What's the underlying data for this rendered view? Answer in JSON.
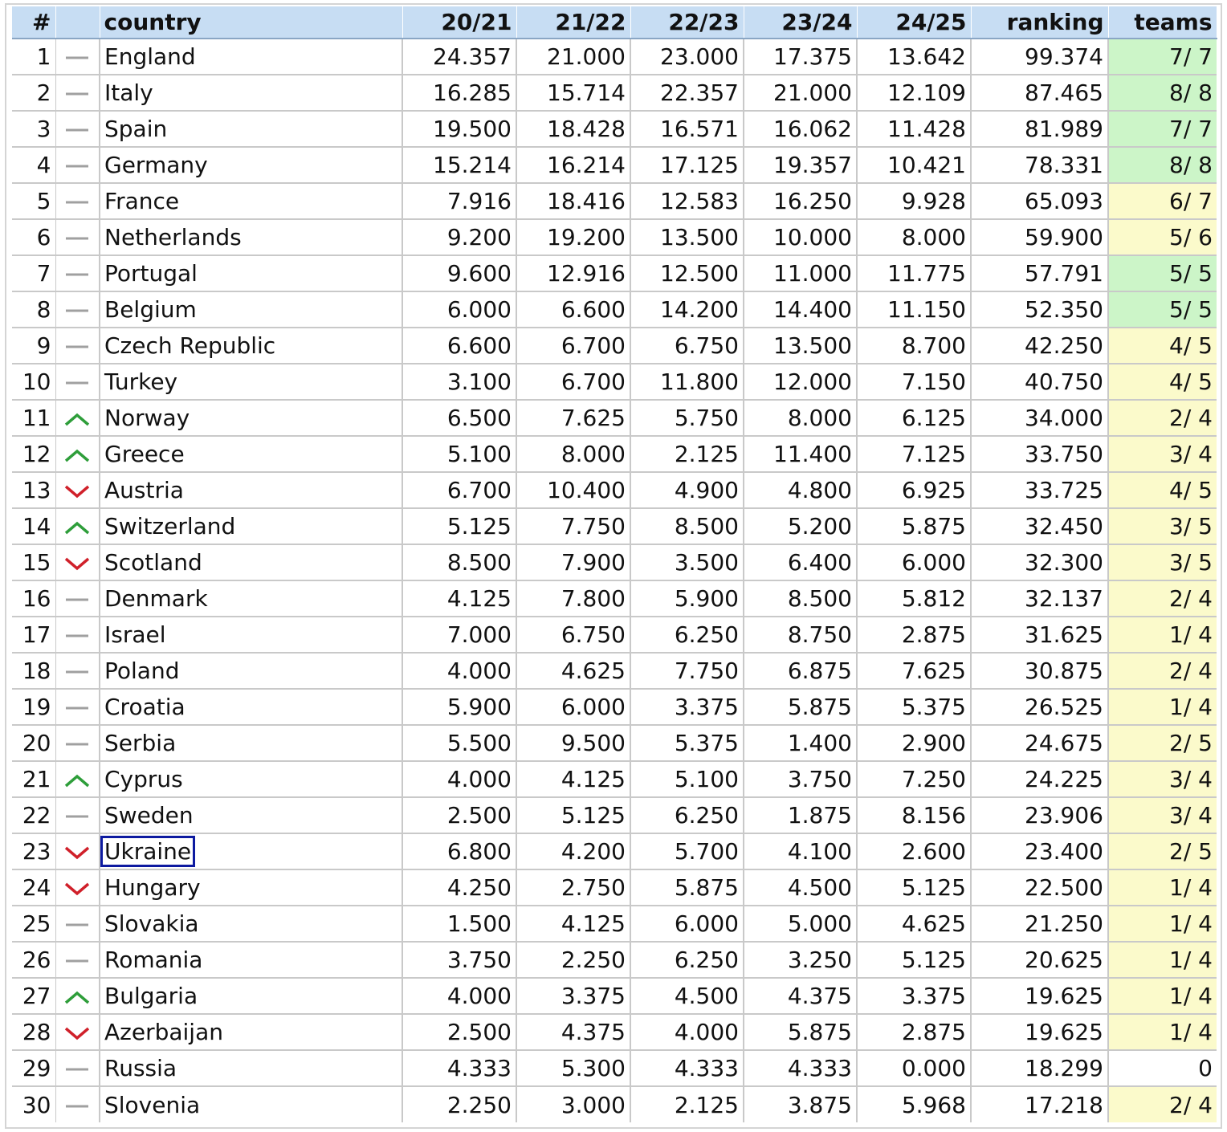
{
  "table": {
    "headers": [
      "#",
      "",
      "country",
      "20/21",
      "21/22",
      "22/23",
      "23/24",
      "24/25",
      "ranking",
      "teams"
    ],
    "selected_country": "Ukraine",
    "colors": {
      "full": "#ccf5c8",
      "partial": "#fbfacb",
      "up": "#2e9e3a",
      "down": "#d0202a",
      "same": "#a0a0a0",
      "header": "#c7ddf3",
      "selection": "#0d1aa0"
    },
    "rows": [
      {
        "rank": "1",
        "trend": "same",
        "country": "England",
        "s1": "24.357",
        "s2": "21.000",
        "s3": "23.000",
        "s4": "17.375",
        "s5": "13.642",
        "ranking": "99.374",
        "teams": "7/ 7",
        "teams_status": "full"
      },
      {
        "rank": "2",
        "trend": "same",
        "country": "Italy",
        "s1": "16.285",
        "s2": "15.714",
        "s3": "22.357",
        "s4": "21.000",
        "s5": "12.109",
        "ranking": "87.465",
        "teams": "8/ 8",
        "teams_status": "full"
      },
      {
        "rank": "3",
        "trend": "same",
        "country": "Spain",
        "s1": "19.500",
        "s2": "18.428",
        "s3": "16.571",
        "s4": "16.062",
        "s5": "11.428",
        "ranking": "81.989",
        "teams": "7/ 7",
        "teams_status": "full"
      },
      {
        "rank": "4",
        "trend": "same",
        "country": "Germany",
        "s1": "15.214",
        "s2": "16.214",
        "s3": "17.125",
        "s4": "19.357",
        "s5": "10.421",
        "ranking": "78.331",
        "teams": "8/ 8",
        "teams_status": "full"
      },
      {
        "rank": "5",
        "trend": "same",
        "country": "France",
        "s1": "7.916",
        "s2": "18.416",
        "s3": "12.583",
        "s4": "16.250",
        "s5": "9.928",
        "ranking": "65.093",
        "teams": "6/ 7",
        "teams_status": "partial"
      },
      {
        "rank": "6",
        "trend": "same",
        "country": "Netherlands",
        "s1": "9.200",
        "s2": "19.200",
        "s3": "13.500",
        "s4": "10.000",
        "s5": "8.000",
        "ranking": "59.900",
        "teams": "5/ 6",
        "teams_status": "partial"
      },
      {
        "rank": "7",
        "trend": "same",
        "country": "Portugal",
        "s1": "9.600",
        "s2": "12.916",
        "s3": "12.500",
        "s4": "11.000",
        "s5": "11.775",
        "ranking": "57.791",
        "teams": "5/ 5",
        "teams_status": "full"
      },
      {
        "rank": "8",
        "trend": "same",
        "country": "Belgium",
        "s1": "6.000",
        "s2": "6.600",
        "s3": "14.200",
        "s4": "14.400",
        "s5": "11.150",
        "ranking": "52.350",
        "teams": "5/ 5",
        "teams_status": "full"
      },
      {
        "rank": "9",
        "trend": "same",
        "country": "Czech Republic",
        "s1": "6.600",
        "s2": "6.700",
        "s3": "6.750",
        "s4": "13.500",
        "s5": "8.700",
        "ranking": "42.250",
        "teams": "4/ 5",
        "teams_status": "partial"
      },
      {
        "rank": "10",
        "trend": "same",
        "country": "Turkey",
        "s1": "3.100",
        "s2": "6.700",
        "s3": "11.800",
        "s4": "12.000",
        "s5": "7.150",
        "ranking": "40.750",
        "teams": "4/ 5",
        "teams_status": "partial"
      },
      {
        "rank": "11",
        "trend": "up",
        "country": "Norway",
        "s1": "6.500",
        "s2": "7.625",
        "s3": "5.750",
        "s4": "8.000",
        "s5": "6.125",
        "ranking": "34.000",
        "teams": "2/ 4",
        "teams_status": "partial"
      },
      {
        "rank": "12",
        "trend": "up",
        "country": "Greece",
        "s1": "5.100",
        "s2": "8.000",
        "s3": "2.125",
        "s4": "11.400",
        "s5": "7.125",
        "ranking": "33.750",
        "teams": "3/ 4",
        "teams_status": "partial"
      },
      {
        "rank": "13",
        "trend": "down",
        "country": "Austria",
        "s1": "6.700",
        "s2": "10.400",
        "s3": "4.900",
        "s4": "4.800",
        "s5": "6.925",
        "ranking": "33.725",
        "teams": "4/ 5",
        "teams_status": "partial"
      },
      {
        "rank": "14",
        "trend": "up",
        "country": "Switzerland",
        "s1": "5.125",
        "s2": "7.750",
        "s3": "8.500",
        "s4": "5.200",
        "s5": "5.875",
        "ranking": "32.450",
        "teams": "3/ 5",
        "teams_status": "partial"
      },
      {
        "rank": "15",
        "trend": "down",
        "country": "Scotland",
        "s1": "8.500",
        "s2": "7.900",
        "s3": "3.500",
        "s4": "6.400",
        "s5": "6.000",
        "ranking": "32.300",
        "teams": "3/ 5",
        "teams_status": "partial"
      },
      {
        "rank": "16",
        "trend": "same",
        "country": "Denmark",
        "s1": "4.125",
        "s2": "7.800",
        "s3": "5.900",
        "s4": "8.500",
        "s5": "5.812",
        "ranking": "32.137",
        "teams": "2/ 4",
        "teams_status": "partial"
      },
      {
        "rank": "17",
        "trend": "same",
        "country": "Israel",
        "s1": "7.000",
        "s2": "6.750",
        "s3": "6.250",
        "s4": "8.750",
        "s5": "2.875",
        "ranking": "31.625",
        "teams": "1/ 4",
        "teams_status": "partial"
      },
      {
        "rank": "18",
        "trend": "same",
        "country": "Poland",
        "s1": "4.000",
        "s2": "4.625",
        "s3": "7.750",
        "s4": "6.875",
        "s5": "7.625",
        "ranking": "30.875",
        "teams": "2/ 4",
        "teams_status": "partial"
      },
      {
        "rank": "19",
        "trend": "same",
        "country": "Croatia",
        "s1": "5.900",
        "s2": "6.000",
        "s3": "3.375",
        "s4": "5.875",
        "s5": "5.375",
        "ranking": "26.525",
        "teams": "1/ 4",
        "teams_status": "partial"
      },
      {
        "rank": "20",
        "trend": "same",
        "country": "Serbia",
        "s1": "5.500",
        "s2": "9.500",
        "s3": "5.375",
        "s4": "1.400",
        "s5": "2.900",
        "ranking": "24.675",
        "teams": "2/ 5",
        "teams_status": "partial"
      },
      {
        "rank": "21",
        "trend": "up",
        "country": "Cyprus",
        "s1": "4.000",
        "s2": "4.125",
        "s3": "5.100",
        "s4": "3.750",
        "s5": "7.250",
        "ranking": "24.225",
        "teams": "3/ 4",
        "teams_status": "partial"
      },
      {
        "rank": "22",
        "trend": "same",
        "country": "Sweden",
        "s1": "2.500",
        "s2": "5.125",
        "s3": "6.250",
        "s4": "1.875",
        "s5": "8.156",
        "ranking": "23.906",
        "teams": "3/ 4",
        "teams_status": "partial"
      },
      {
        "rank": "23",
        "trend": "down",
        "country": "Ukraine",
        "s1": "6.800",
        "s2": "4.200",
        "s3": "5.700",
        "s4": "4.100",
        "s5": "2.600",
        "ranking": "23.400",
        "teams": "2/ 5",
        "teams_status": "partial"
      },
      {
        "rank": "24",
        "trend": "down",
        "country": "Hungary",
        "s1": "4.250",
        "s2": "2.750",
        "s3": "5.875",
        "s4": "4.500",
        "s5": "5.125",
        "ranking": "22.500",
        "teams": "1/ 4",
        "teams_status": "partial"
      },
      {
        "rank": "25",
        "trend": "same",
        "country": "Slovakia",
        "s1": "1.500",
        "s2": "4.125",
        "s3": "6.000",
        "s4": "5.000",
        "s5": "4.625",
        "ranking": "21.250",
        "teams": "1/ 4",
        "teams_status": "partial"
      },
      {
        "rank": "26",
        "trend": "same",
        "country": "Romania",
        "s1": "3.750",
        "s2": "2.250",
        "s3": "6.250",
        "s4": "3.250",
        "s5": "5.125",
        "ranking": "20.625",
        "teams": "1/ 4",
        "teams_status": "partial"
      },
      {
        "rank": "27",
        "trend": "up",
        "country": "Bulgaria",
        "s1": "4.000",
        "s2": "3.375",
        "s3": "4.500",
        "s4": "4.375",
        "s5": "3.375",
        "ranking": "19.625",
        "teams": "1/ 4",
        "teams_status": "partial"
      },
      {
        "rank": "28",
        "trend": "down",
        "country": "Azerbaijan",
        "s1": "2.500",
        "s2": "4.375",
        "s3": "4.000",
        "s4": "5.875",
        "s5": "2.875",
        "ranking": "19.625",
        "teams": "1/ 4",
        "teams_status": "partial"
      },
      {
        "rank": "29",
        "trend": "same",
        "country": "Russia",
        "s1": "4.333",
        "s2": "5.300",
        "s3": "4.333",
        "s4": "4.333",
        "s5": "0.000",
        "ranking": "18.299",
        "teams": "0",
        "teams_status": "none"
      },
      {
        "rank": "30",
        "trend": "same",
        "country": "Slovenia",
        "s1": "2.250",
        "s2": "3.000",
        "s3": "2.125",
        "s4": "3.875",
        "s5": "5.968",
        "ranking": "17.218",
        "teams": "2/ 4",
        "teams_status": "partial"
      }
    ]
  }
}
